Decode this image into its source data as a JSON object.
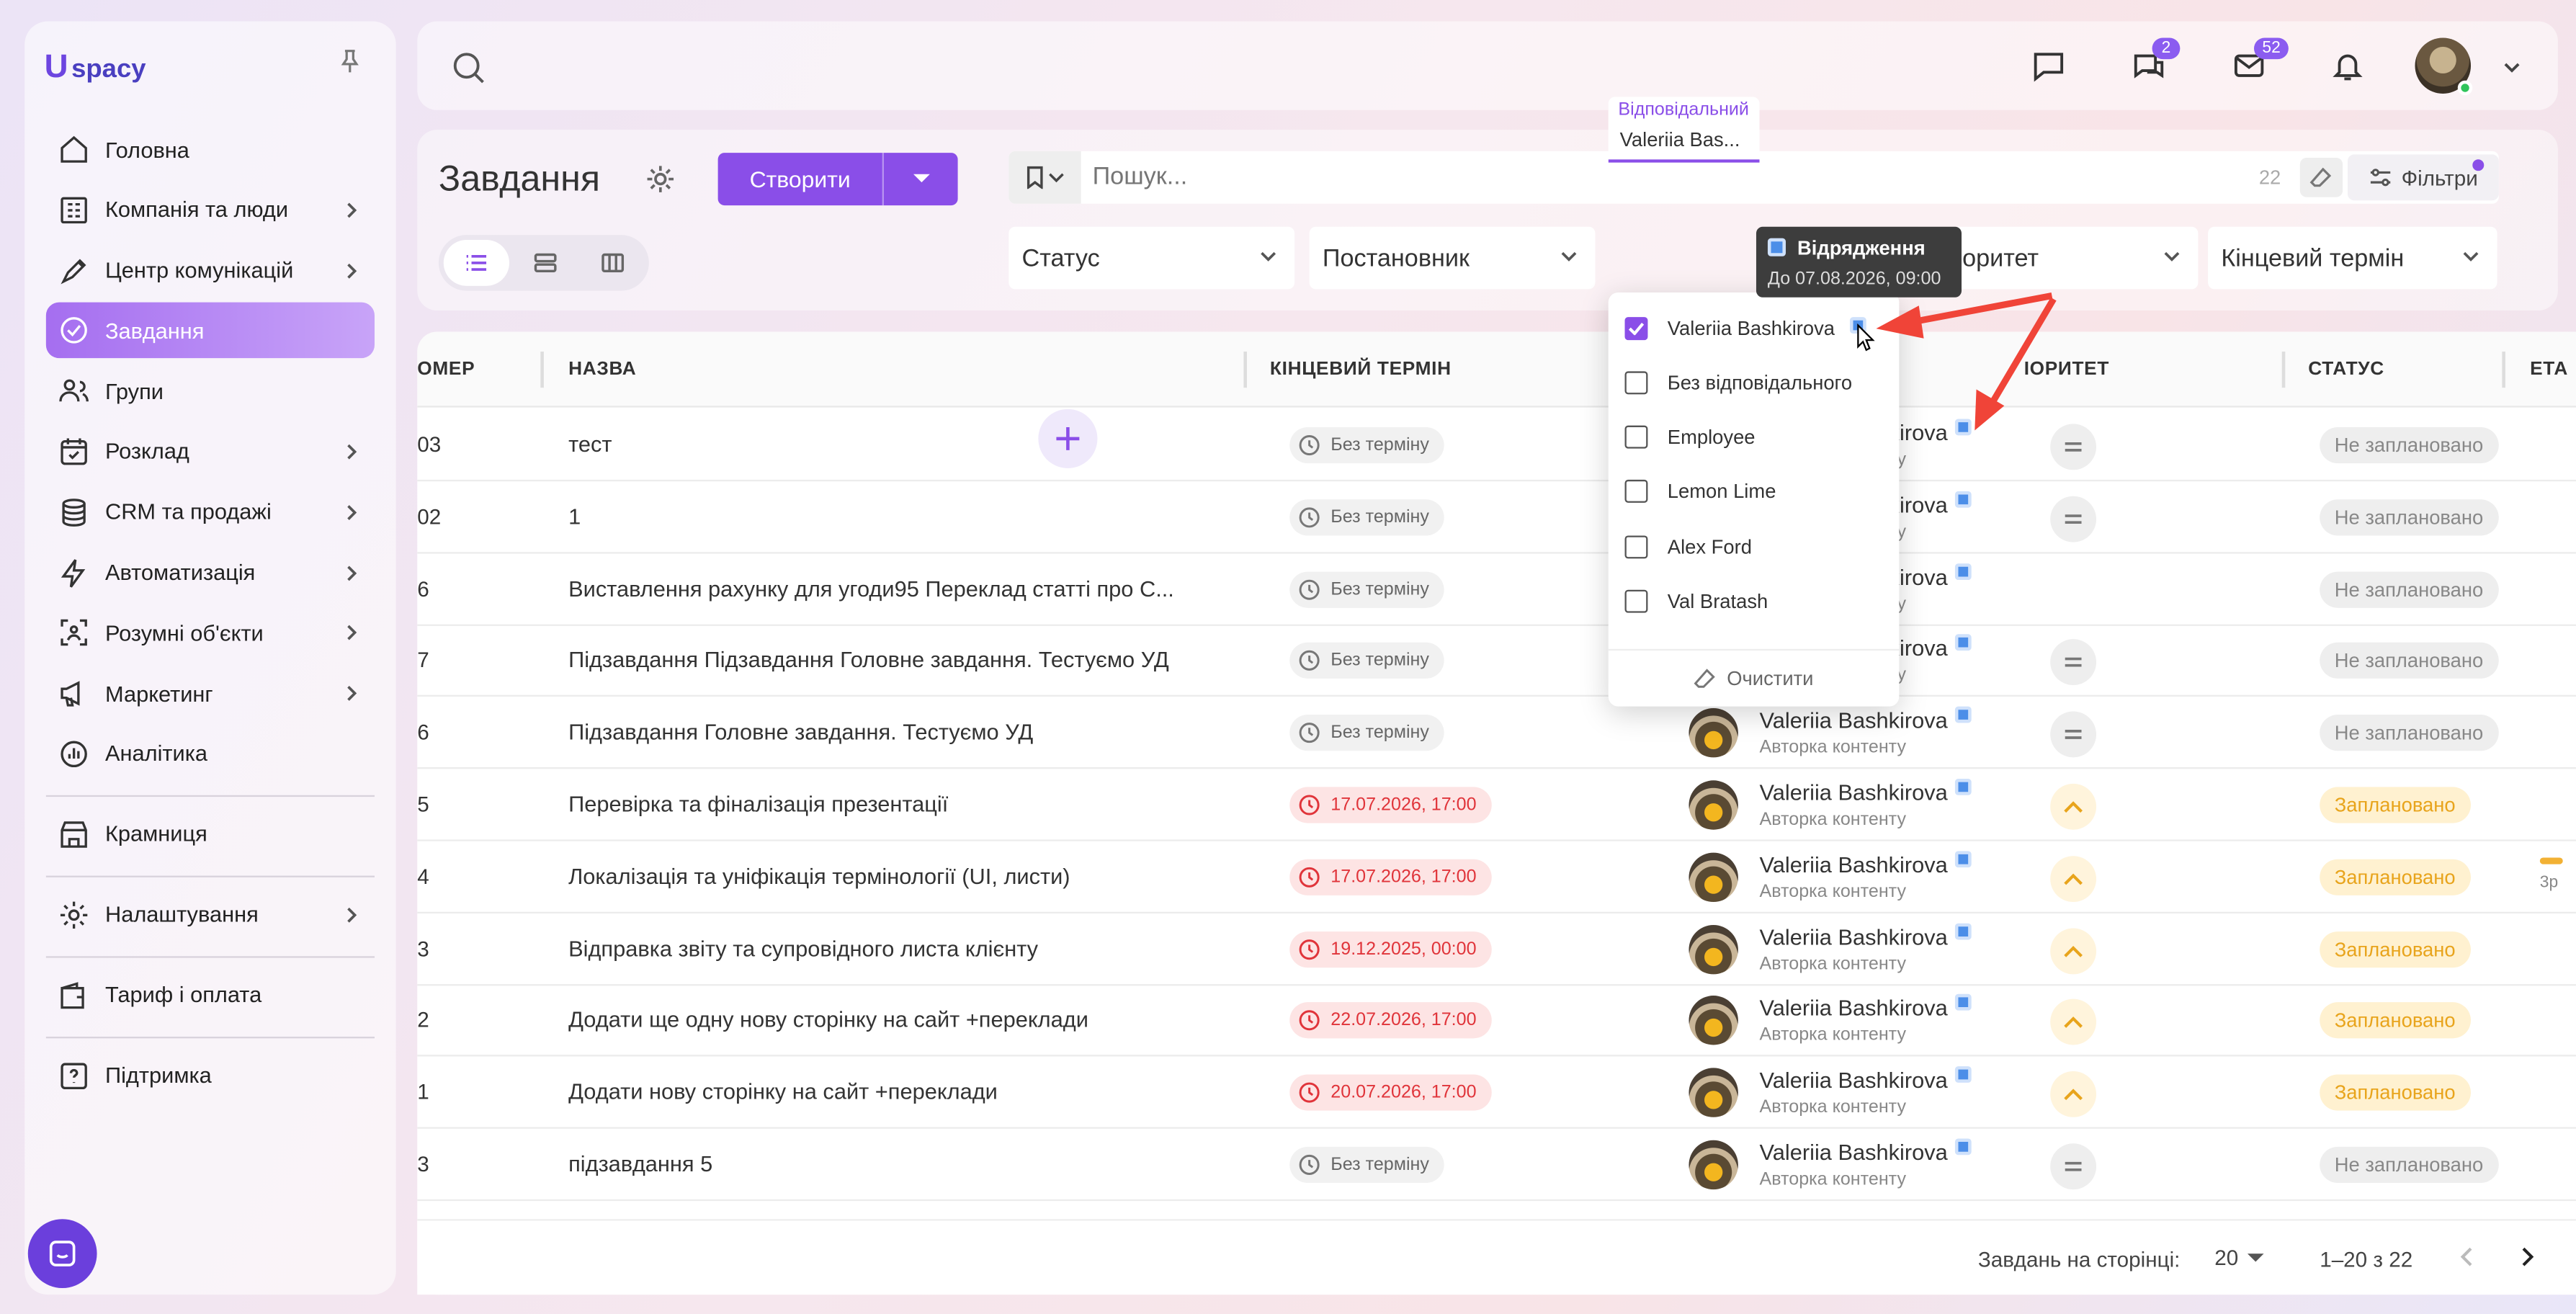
{
  "app": {
    "logo_u": "U",
    "logo_text": "spacy"
  },
  "colors": {
    "accent": "#8a4ee8",
    "overdue": "#e0343a",
    "planned": "#e8a41c",
    "arrow": "#f04438"
  },
  "sidebar": {
    "items": [
      {
        "label": "Головна",
        "icon": "home-icon",
        "chev": false
      },
      {
        "label": "Компанія та люди",
        "icon": "company-icon",
        "chev": true
      },
      {
        "label": "Центр комунікацій",
        "icon": "communications-icon",
        "chev": true
      },
      {
        "label": "Завдання",
        "icon": "tasks-icon",
        "chev": false,
        "active": true
      },
      {
        "label": "Групи",
        "icon": "groups-icon",
        "chev": false
      },
      {
        "label": "Розклад",
        "icon": "calendar-icon",
        "chev": true
      },
      {
        "label": "CRM та продажі",
        "icon": "crm-icon",
        "chev": true
      },
      {
        "label": "Автоматизація",
        "icon": "automation-icon",
        "chev": true
      },
      {
        "label": "Розумні об'єкти",
        "icon": "smart-objects-icon",
        "chev": true
      },
      {
        "label": "Маркетинг",
        "icon": "marketing-icon",
        "chev": true
      },
      {
        "label": "Аналітика",
        "icon": "analytics-icon",
        "chev": false
      }
    ],
    "items2": [
      {
        "label": "Крамниця",
        "icon": "store-icon",
        "chev": false
      }
    ],
    "items3": [
      {
        "label": "Налаштування",
        "icon": "settings-icon",
        "chev": true
      }
    ],
    "items4": [
      {
        "label": "Тариф і оплата",
        "icon": "wallet-icon",
        "chev": false
      }
    ],
    "items5": [
      {
        "label": "Підтримка",
        "icon": "support-icon",
        "chev": false
      }
    ]
  },
  "topbar": {
    "chat_badge": "2",
    "mail_badge": "52"
  },
  "header": {
    "title": "Завдання",
    "create_label": "Створити",
    "search_placeholder": "Пошук...",
    "count": "22",
    "filters_label": "Фільтри"
  },
  "filters": {
    "status": "Статус",
    "author": "Постановник",
    "responsible_label": "Відповідальний",
    "responsible_value": "Valeriia Bas...",
    "priority": "Пріоритет",
    "deadline": "Кінцевий термін"
  },
  "tooltip": {
    "title": "Відрядження",
    "subtitle": "До 07.08.2026, 09:00"
  },
  "dropdown": {
    "options": [
      {
        "label": "Valeriia Bashkirova",
        "checked": true
      },
      {
        "label": "Без відповідального",
        "checked": false
      },
      {
        "label": "Employee",
        "checked": false
      },
      {
        "label": "Lemon Lime",
        "checked": false
      },
      {
        "label": "Alex Ford",
        "checked": false
      },
      {
        "label": "Val Bratash",
        "checked": false
      }
    ],
    "clear_label": "Очистити"
  },
  "table": {
    "headers": {
      "num": "ОМЕР",
      "name": "НАЗВА",
      "deadline": "КІНЦЕВИЙ ТЕРМІН",
      "priority": "ІОРИТЕТ",
      "status": "СТАТУС",
      "stage": "ЕТА"
    },
    "rows": [
      {
        "num": "03",
        "name": "тест",
        "deadline": "Без терміну",
        "overdue": false,
        "person": "Valeriia Bashkirova",
        "role": "Авторка контенту",
        "prio": "medium",
        "status": "Не заплановано"
      },
      {
        "num": "02",
        "name": "1",
        "deadline": "Без терміну",
        "overdue": false,
        "person": "Valeriia Bashkirova",
        "role": "Авторка контенту",
        "prio": "medium",
        "status": "Не заплановано"
      },
      {
        "num": "6",
        "name": "Виставлення рахунку для угоди95 Переклад статті про С...",
        "deadline": "Без терміну",
        "overdue": false,
        "person": "Valeriia Bashkirova",
        "role": "Авторка контенту",
        "prio": "none",
        "status": "Не заплановано"
      },
      {
        "num": "7",
        "name": "Підзавдання Підзавдання Головне завдання. Тестуємо УД",
        "deadline": "Без терміну",
        "overdue": false,
        "person": "Valeriia Bashkirova",
        "role": "Авторка контенту",
        "prio": "medium",
        "status": "Не заплановано"
      },
      {
        "num": "6",
        "name": "Підзавдання Головне завдання. Тестуємо УД",
        "deadline": "Без терміну",
        "overdue": false,
        "person": "Valeriia Bashkirova",
        "role": "Авторка контенту",
        "prio": "medium",
        "status": "Не заплановано"
      },
      {
        "num": "5",
        "name": "Перевірка та фіналізація презентації",
        "deadline": "17.07.2026, 17:00",
        "overdue": true,
        "person": "Valeriia Bashkirova",
        "role": "Авторка контенту",
        "prio": "high",
        "status": "Заплановано"
      },
      {
        "num": "4",
        "name": "Локалізація та уніфікація термінології (UI, листи)",
        "deadline": "17.07.2026, 17:00",
        "overdue": true,
        "person": "Valeriia Bashkirova",
        "role": "Авторка контенту",
        "prio": "high",
        "status": "Заплановано",
        "stage": "3р"
      },
      {
        "num": "3",
        "name": "Відправка звіту та супровідного листа клієнту",
        "deadline": "19.12.2025, 00:00",
        "overdue": true,
        "person": "Valeriia Bashkirova",
        "role": "Авторка контенту",
        "prio": "high",
        "status": "Заплановано"
      },
      {
        "num": "2",
        "name": "Додати ще одну нову сторінку на сайт +переклади",
        "deadline": "22.07.2026, 17:00",
        "overdue": true,
        "person": "Valeriia Bashkirova",
        "role": "Авторка контенту",
        "prio": "high",
        "status": "Заплановано"
      },
      {
        "num": "1",
        "name": "Додати нову сторінку на сайт +переклади",
        "deadline": "20.07.2026, 17:00",
        "overdue": true,
        "person": "Valeriia Bashkirova",
        "role": "Авторка контенту",
        "prio": "high",
        "status": "Заплановано"
      },
      {
        "num": "3",
        "name": "підзавдання 5",
        "deadline": "Без терміну",
        "overdue": false,
        "person": "Valeriia Bashkirova",
        "role": "Авторка контенту",
        "prio": "medium",
        "status": "Не заплановано"
      }
    ]
  },
  "footer": {
    "per_page_label": "Завдань на сторінці:",
    "per_page": "20",
    "range": "1–20 з 22"
  }
}
